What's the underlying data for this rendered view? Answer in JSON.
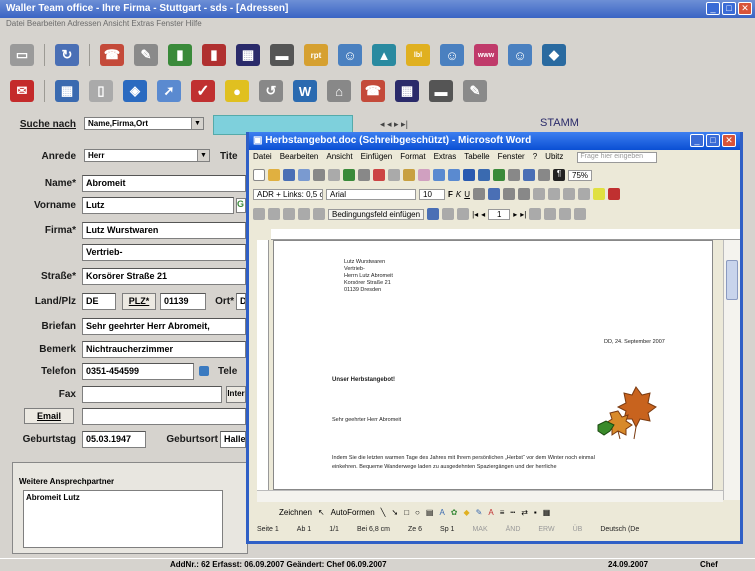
{
  "app": {
    "title": "Waller Team office - Ihre Firma - Stuttgart - sds - [Adressen]",
    "menu": "Datei  Bearbeiten  Adressen  Ansicht  Extras  Fenster  Hilfe"
  },
  "search": {
    "label": "Suche nach",
    "combo": "Name,Firma,Ort",
    "section": "STAMM"
  },
  "form": {
    "anrede_label": "Anrede",
    "anrede": "Herr",
    "titel_label": "Tite",
    "name_label": "Name*",
    "name": "Abromeit",
    "vorname_label": "Vorname",
    "vorname": "Lutz",
    "firma_label": "Firma*",
    "firma1": "Lutz Wurstwaren",
    "firma2": "Vertrieb-",
    "strasse_label": "Straße*",
    "strasse": "Korsörer Straße 21",
    "land_label": "Land/Plz",
    "land": "DE",
    "plz_btn": "PLZ*",
    "plz": "01139",
    "ort_label": "Ort*",
    "ort": "D",
    "briefan_label": "Briefan",
    "briefan": "Sehr geehrter Herr Abromeit,",
    "bemerk_label": "Bemerk",
    "bemerk": "Nichtraucherzimmer",
    "telefon_label": "Telefon",
    "telefon": "0351-454599",
    "tele2_label": "Tele",
    "fax_label": "Fax",
    "inter_btn": "Inter",
    "email_btn": "Email",
    "geb_label": "Geburtstag",
    "geb": "05.03.1947",
    "gebort_label": "Geburtsort",
    "gebort": "Halle"
  },
  "contacts": {
    "label": "Weitere Ansprechpartner",
    "item": "Abromeit Lutz"
  },
  "status": {
    "left": "AddNr.: 62  Erfasst: 06.09.2007  Geändert: Chef 06.09.2007",
    "date": "24.09.2007",
    "user": "Chef"
  },
  "word": {
    "title": "Herbstangebot.doc (Schreibgeschützt) - Microsoft Word",
    "menu": [
      "Datei",
      "Bearbeiten",
      "Ansicht",
      "Einfügen",
      "Format",
      "Extras",
      "Tabelle",
      "Fenster",
      "?",
      "Ubitz"
    ],
    "help_placeholder": "Frage hier eingeben",
    "style": "ADR + Links: 0,5 cm",
    "font": "Arial",
    "size": "10",
    "zoom": "75%",
    "mailmerge": "Bedingungsfeld einfügen",
    "address": [
      "Lutz Wurstwaren",
      "Vertrieb-",
      "Herrn Lutz Abromeit",
      "Korsörer Straße 21",
      "01139 Dresden"
    ],
    "date": "DD, 24. September 2007",
    "subject": "Unser Herbstangebot!",
    "salutation": "Sehr geehrter Herr Abromeit",
    "body1": "Indem Sie die letzten warmen Tage des Jahres mit Ihrem persönlichen „Herbst“ vor dem Winter noch einmal",
    "body2": "einkehren.   Bequeme   Wanderwege   laden   zu   ausgedehnten   Spaziergängen   und   der   herrliche",
    "drawbar": [
      "Zeichnen",
      "AutoFormen"
    ],
    "status": [
      "Seite 1",
      "Ab 1",
      "1/1",
      "Bei 6,8 cm",
      "Ze 6",
      "Sp 1",
      "MAK",
      "ÄND",
      "ERW",
      "ÜB",
      "Deutsch (De"
    ]
  }
}
